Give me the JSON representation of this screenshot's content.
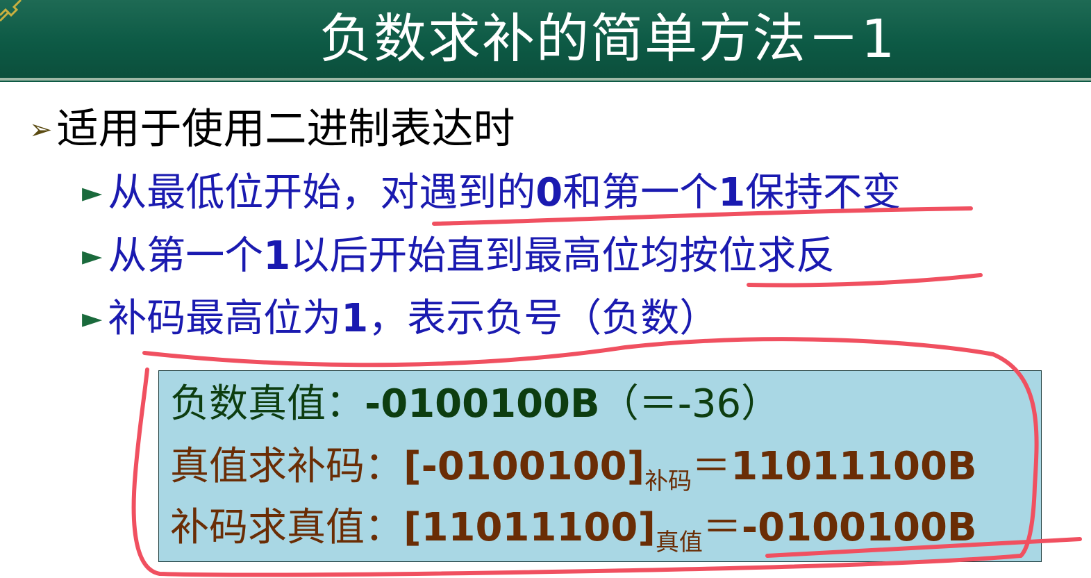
{
  "title": "负数求补的简单方法－1",
  "bullet_main": {
    "text": "适用于使用二进制表达时"
  },
  "sub_bullets": [
    {
      "parts": [
        {
          "t": "从最低位开始，对遇到的",
          "b": false
        },
        {
          "t": "0",
          "b": true
        },
        {
          "t": "和第一个",
          "b": false
        },
        {
          "t": "1",
          "b": true
        },
        {
          "t": "保持不变",
          "b": false
        }
      ]
    },
    {
      "parts": [
        {
          "t": "从第一个",
          "b": false
        },
        {
          "t": "1",
          "b": true
        },
        {
          "t": "以后开始直到最高位均按位求反",
          "b": false
        }
      ]
    },
    {
      "parts": [
        {
          "t": "补码最高位为",
          "b": false
        },
        {
          "t": "1",
          "b": true
        },
        {
          "t": "，表示负号（负数）",
          "b": false
        }
      ]
    }
  ],
  "box": {
    "line1": {
      "label": "负数真值：",
      "value": "-0100100B",
      "note": "（＝-36）"
    },
    "line2": {
      "label": "真值求补码：",
      "expr": "[-0100100]",
      "sub": "补码",
      "eq": "＝",
      "result": "11011100B"
    },
    "line3": {
      "label": "补码求真值：",
      "expr": "[11011100]",
      "sub": "真值",
      "eq": "＝",
      "result": "-0100100B"
    }
  },
  "colors": {
    "header_green": "#0d5a45",
    "title_text": "#ffffff",
    "sub_bullet_text": "#1a1ab0",
    "box_bg": "#a9d7e4",
    "box_line1": "#0d3d10",
    "box_line23": "#6a2d05",
    "annotation_red": "#f05060"
  },
  "icons": {
    "main_bullet": "arrow-bullet-icon",
    "sub_bullet": "triangle-bullet-icon"
  }
}
